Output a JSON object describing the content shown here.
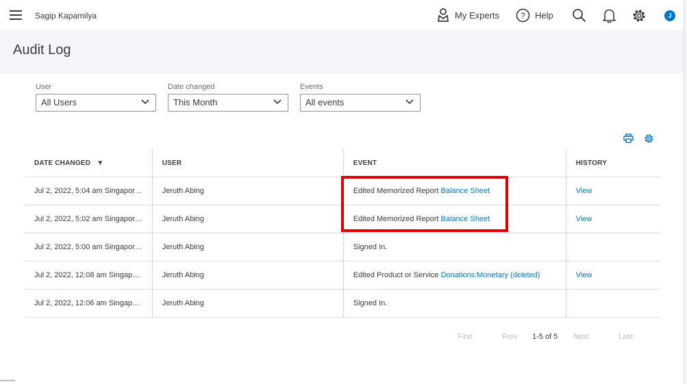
{
  "topbar": {
    "company_name": "Sagip Kapamilya",
    "my_experts_label": "My Experts",
    "help_label": "Help",
    "avatar_initial": "J"
  },
  "page": {
    "title": "Audit Log"
  },
  "filters": {
    "user": {
      "label": "User",
      "value": "All Users"
    },
    "date": {
      "label": "Date changed",
      "value": "This Month"
    },
    "events": {
      "label": "Events",
      "value": "All events"
    }
  },
  "table": {
    "columns": {
      "date": "DATE CHANGED",
      "sort_indicator": "▼",
      "user": "USER",
      "event": "EVENT",
      "history": "HISTORY"
    },
    "rows": [
      {
        "date": "Jul 2, 2022, 5:04 am Singapor…",
        "user": "Jeruth Abing",
        "event_text": "Edited Memorized Report ",
        "event_link": "Balance Sheet",
        "history": "View"
      },
      {
        "date": "Jul 2, 2022, 5:02 am Singapor…",
        "user": "Jeruth Abing",
        "event_text": "Edited Memorized Report ",
        "event_link": "Balance Sheet",
        "history": "View"
      },
      {
        "date": "Jul 2, 2022, 5:00 am Singapor…",
        "user": "Jeruth Abing",
        "event_text": "Signed In.",
        "event_link": "",
        "history": ""
      },
      {
        "date": "Jul 2, 2022, 12:08 am Singap…",
        "user": "Jeruth Abing",
        "event_text": "Edited Product or Service ",
        "event_link": "Donations:Monetary (deleted)",
        "history": "View"
      },
      {
        "date": "Jul 2, 2022, 12:06 am Singap…",
        "user": "Jeruth Abing",
        "event_text": "Signed In.",
        "event_link": "",
        "history": ""
      }
    ]
  },
  "pagination": {
    "first": "First",
    "prev": "Prev",
    "range": "1-5 of 5",
    "next": "Next",
    "last": "Last"
  },
  "colors": {
    "accent": "#0077c5",
    "highlight": "#e00000",
    "header_bg": "#f4f5f8",
    "text": "#393a3d"
  },
  "icons": [
    "menu-icon",
    "person-icon",
    "help-icon",
    "search-icon",
    "bell-icon",
    "gear-icon",
    "print-icon",
    "settings-icon",
    "chevron-down-icon"
  ]
}
